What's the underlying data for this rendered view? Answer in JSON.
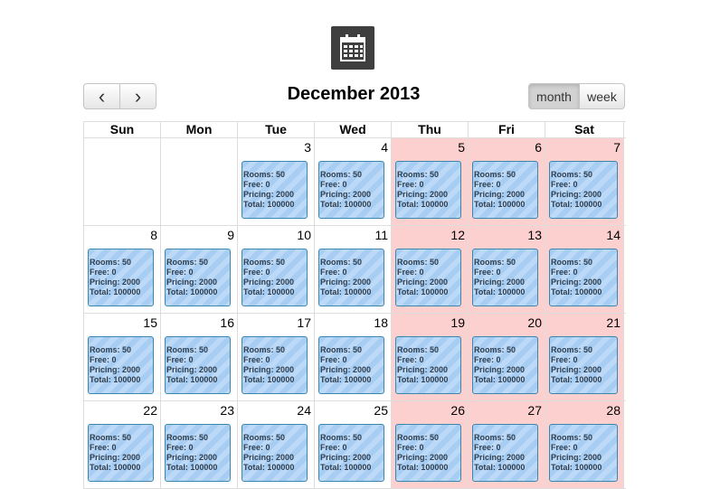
{
  "header": {
    "icon": "calendar-icon",
    "title": "December 2013",
    "prev_icon": "chevron-left-icon",
    "next_icon": "chevron-right-icon",
    "prev_glyph": "‹",
    "next_glyph": "›",
    "views": {
      "month": "month",
      "week": "week",
      "active": "month"
    }
  },
  "weekdays": [
    "Sun",
    "Mon",
    "Tue",
    "Wed",
    "Thu",
    "Fri",
    "Sat"
  ],
  "colors": {
    "weekend_bg": "#fdd0d0",
    "event_border": "#3a87ad",
    "event_bg": "#a7cdf3"
  },
  "weeks": [
    [
      {
        "day": "",
        "event": null
      },
      {
        "day": "",
        "event": null
      },
      {
        "day": "3",
        "weekend": false,
        "event": {
          "rooms": "Rooms: 50",
          "free": "Free: 0",
          "pricing": "Pricing: 2000",
          "total": "Total: 100000"
        }
      },
      {
        "day": "4",
        "weekend": false,
        "event": {
          "rooms": "Rooms: 50",
          "free": "Free: 0",
          "pricing": "Pricing: 2000",
          "total": "Total: 100000"
        }
      },
      {
        "day": "5",
        "weekend": true,
        "event": {
          "rooms": "Rooms: 50",
          "free": "Free: 0",
          "pricing": "Pricing: 2000",
          "total": "Total: 100000"
        }
      },
      {
        "day": "6",
        "weekend": true,
        "event": {
          "rooms": "Rooms: 50",
          "free": "Free: 0",
          "pricing": "Pricing: 2000",
          "total": "Total: 100000"
        }
      },
      {
        "day": "7",
        "weekend": true,
        "event": {
          "rooms": "Rooms: 50",
          "free": "Free: 0",
          "pricing": "Pricing: 2000",
          "total": "Total: 100000"
        }
      }
    ],
    [
      {
        "day": "8",
        "weekend": false,
        "event": {
          "rooms": "Rooms: 50",
          "free": "Free: 0",
          "pricing": "Pricing: 2000",
          "total": "Total: 100000"
        }
      },
      {
        "day": "9",
        "weekend": false,
        "event": {
          "rooms": "Rooms: 50",
          "free": "Free: 0",
          "pricing": "Pricing: 2000",
          "total": "Total: 100000"
        }
      },
      {
        "day": "10",
        "weekend": false,
        "event": {
          "rooms": "Rooms: 50",
          "free": "Free: 0",
          "pricing": "Pricing: 2000",
          "total": "Total: 100000"
        }
      },
      {
        "day": "11",
        "weekend": false,
        "event": {
          "rooms": "Rooms: 50",
          "free": "Free: 0",
          "pricing": "Pricing: 2000",
          "total": "Total: 100000"
        }
      },
      {
        "day": "12",
        "weekend": true,
        "event": {
          "rooms": "Rooms: 50",
          "free": "Free: 0",
          "pricing": "Pricing: 2000",
          "total": "Total: 100000"
        }
      },
      {
        "day": "13",
        "weekend": true,
        "event": {
          "rooms": "Rooms: 50",
          "free": "Free: 0",
          "pricing": "Pricing: 2000",
          "total": "Total: 100000"
        }
      },
      {
        "day": "14",
        "weekend": true,
        "event": {
          "rooms": "Rooms: 50",
          "free": "Free: 0",
          "pricing": "Pricing: 2000",
          "total": "Total: 100000"
        }
      }
    ],
    [
      {
        "day": "15",
        "weekend": false,
        "event": {
          "rooms": "Rooms: 50",
          "free": "Free: 0",
          "pricing": "Pricing: 2000",
          "total": "Total: 100000"
        }
      },
      {
        "day": "16",
        "weekend": false,
        "event": {
          "rooms": "Rooms: 50",
          "free": "Free: 0",
          "pricing": "Pricing: 2000",
          "total": "Total: 100000"
        }
      },
      {
        "day": "17",
        "weekend": false,
        "event": {
          "rooms": "Rooms: 50",
          "free": "Free: 0",
          "pricing": "Pricing: 2000",
          "total": "Total: 100000"
        }
      },
      {
        "day": "18",
        "weekend": false,
        "event": {
          "rooms": "Rooms: 50",
          "free": "Free: 0",
          "pricing": "Pricing: 2000",
          "total": "Total: 100000"
        }
      },
      {
        "day": "19",
        "weekend": true,
        "event": {
          "rooms": "Rooms: 50",
          "free": "Free: 0",
          "pricing": "Pricing: 2000",
          "total": "Total: 100000"
        }
      },
      {
        "day": "20",
        "weekend": true,
        "event": {
          "rooms": "Rooms: 50",
          "free": "Free: 0",
          "pricing": "Pricing: 2000",
          "total": "Total: 100000"
        }
      },
      {
        "day": "21",
        "weekend": true,
        "event": {
          "rooms": "Rooms: 50",
          "free": "Free: 0",
          "pricing": "Pricing: 2000",
          "total": "Total: 100000"
        }
      }
    ],
    [
      {
        "day": "22",
        "weekend": false,
        "event": {
          "rooms": "Rooms: 50",
          "free": "Free: 0",
          "pricing": "Pricing: 2000",
          "total": "Total: 100000"
        }
      },
      {
        "day": "23",
        "weekend": false,
        "event": {
          "rooms": "Rooms: 50",
          "free": "Free: 0",
          "pricing": "Pricing: 2000",
          "total": "Total: 100000"
        }
      },
      {
        "day": "24",
        "weekend": false,
        "event": {
          "rooms": "Rooms: 50",
          "free": "Free: 0",
          "pricing": "Pricing: 2000",
          "total": "Total: 100000"
        }
      },
      {
        "day": "25",
        "weekend": false,
        "event": {
          "rooms": "Rooms: 50",
          "free": "Free: 0",
          "pricing": "Pricing: 2000",
          "total": "Total: 100000"
        }
      },
      {
        "day": "26",
        "weekend": true,
        "event": {
          "rooms": "Rooms: 50",
          "free": "Free: 0",
          "pricing": "Pricing: 2000",
          "total": "Total: 100000"
        }
      },
      {
        "day": "27",
        "weekend": true,
        "event": {
          "rooms": "Rooms: 50",
          "free": "Free: 0",
          "pricing": "Pricing: 2000",
          "total": "Total: 100000"
        }
      },
      {
        "day": "28",
        "weekend": true,
        "event": {
          "rooms": "Rooms: 50",
          "free": "Free: 0",
          "pricing": "Pricing: 2000",
          "total": "Total: 100000"
        }
      }
    ]
  ]
}
